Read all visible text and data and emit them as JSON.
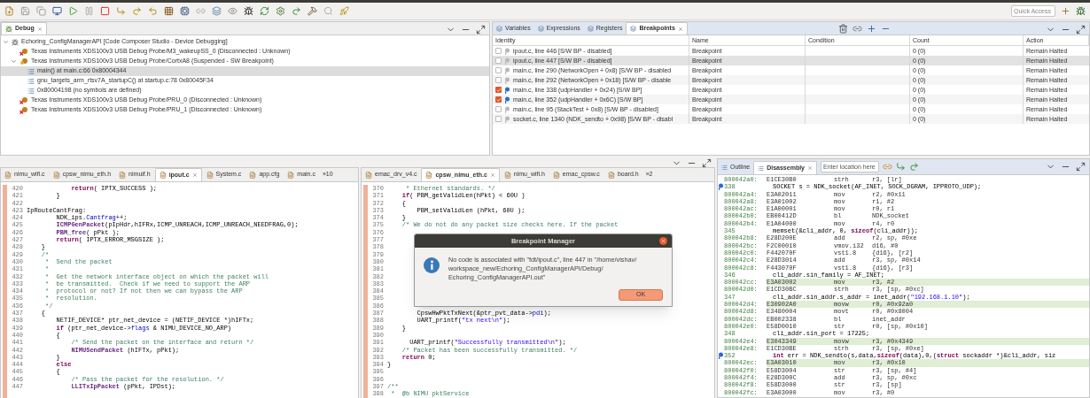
{
  "toolbar": {
    "quick_access": {
      "placeholder": "Quick Access"
    }
  },
  "debug": {
    "tab": {
      "label": "Debug",
      "selected": true
    },
    "tree": [
      {
        "label": "Echoring_ConfigManagerAPI [Code Composer Studio - Device Debugging]",
        "kind": "session",
        "expanded": true,
        "selected": false,
        "children": [
          {
            "label": "Texas Instruments XDS100v3 USB Debug Probe/M3_wakeupSS_0 (Disconnected : Unknown)",
            "kind": "target_off",
            "selected": false
          },
          {
            "label": "Texas Instruments XDS100v3 USB Debug Probe/CortxA8 (Suspended - SW Breakpoint)",
            "kind": "target_on",
            "expanded": true,
            "selected": false,
            "children": [
              {
                "label": "main() at main.c:66 0x80004344",
                "kind": "frame",
                "selected": true
              },
              {
                "label": "gnu_targets_arm_rtsv7A_startupC() at startup.c:78 0x80045F34",
                "kind": "frame",
                "selected": false
              },
              {
                "label": "0x80004198  (no symbols are defined)",
                "kind": "frame",
                "selected": false
              }
            ]
          },
          {
            "label": "Texas Instruments XDS100v3 USB Debug Probe/PRU_0 (Disconnected : Unknown)",
            "kind": "target_off",
            "selected": false
          },
          {
            "label": "Texas Instruments XDS100v3 USB Debug Probe/PRU_1 (Disconnected : Unknown)",
            "kind": "target_off",
            "selected": false
          }
        ]
      }
    ]
  },
  "views": {
    "tabs": [
      {
        "label": "Variables",
        "selected": false
      },
      {
        "label": "Expressions",
        "selected": false
      },
      {
        "label": "Registers",
        "selected": false
      },
      {
        "label": "Breakpoints",
        "selected": true
      }
    ],
    "breakpoints": {
      "columns": [
        "Identity",
        "Name",
        "Condition",
        "Count",
        "Action"
      ],
      "rows": [
        {
          "identity": "ipout.c, line 446 [S/W BP - disabled]",
          "checked": false,
          "selected": false,
          "name": "Breakpoint",
          "count": "0 (0)",
          "action": "Remain Halted"
        },
        {
          "identity": "ipout.c, line 447 [S/W BP - disabled]",
          "checked": false,
          "selected": true,
          "name": "Breakpoint",
          "count": "0 (0)",
          "action": "Remain Halted"
        },
        {
          "identity": "main.c, line 290 (NetworkOpen + 0x8)  [S/W BP - disabled",
          "checked": false,
          "selected": false,
          "name": "Breakpoint",
          "count": "0 (0)",
          "action": "Remain Halted"
        },
        {
          "identity": "main.c, line 292 (NetworkOpen + 0x18)  [S/W BP - disable",
          "checked": false,
          "selected": false,
          "name": "Breakpoint",
          "count": "0 (0)",
          "action": "Remain Halted"
        },
        {
          "identity": "main.c, line 338 (udpHandler + 0x24)  [S/W BP]",
          "checked": true,
          "selected": false,
          "name": "Breakpoint",
          "count": "0 (0)",
          "action": "Remain Halted"
        },
        {
          "identity": "main.c, line 352 (udpHandler + 0x6C)  [S/W BP]",
          "checked": true,
          "selected": false,
          "name": "Breakpoint",
          "count": "0 (0)",
          "action": "Remain Halted"
        },
        {
          "identity": "main.c, line 95 (StackTest + 0x8)  [S/W BP - disabled]",
          "checked": false,
          "selected": false,
          "name": "Breakpoint",
          "count": "0 (0)",
          "action": "Remain Halted"
        },
        {
          "identity": "socket.c, line 1340 (NDK_sendto + 0x98)  [S/W BP - disabl",
          "checked": false,
          "selected": false,
          "name": "Breakpoint",
          "count": "0 (0)",
          "action": "Remain Halted"
        }
      ]
    }
  },
  "editor_left": {
    "tabs": [
      {
        "label": "nimu_wifi.c",
        "selected": false
      },
      {
        "label": "cpsw_nimu_eth.h",
        "selected": false
      },
      {
        "label": "nimuif.h",
        "selected": false
      },
      {
        "label": "ipout.c",
        "selected": true
      },
      {
        "label": "System.c",
        "selected": false
      },
      {
        "label": "app.cfg",
        "selected": false
      },
      {
        "label": "main.c",
        "selected": false
      }
    ],
    "overflow": "»10",
    "lines": [
      {
        "n": "420",
        "code": [
          {
            "kind": "kw",
            "text": "            return"
          },
          {
            "kind": "p",
            "text": "( IPTX_SUCCESS );"
          }
        ]
      },
      {
        "n": "421",
        "code": [
          {
            "kind": "p",
            "text": "        }"
          }
        ]
      },
      {
        "n": "422"
      },
      {
        "n": "423",
        "code": [
          {
            "kind": "p",
            "text": "IpRouteCantFrag:"
          }
        ]
      },
      {
        "n": "424",
        "code": [
          {
            "kind": "p",
            "text": "        NDK_ips."
          },
          {
            "kind": "fd",
            "text": "Cantfrag"
          },
          {
            "kind": "p",
            "text": "++;"
          }
        ]
      },
      {
        "n": "425",
        "code": [
          {
            "kind": "fn",
            "text": "        ICMPGenPacket"
          },
          {
            "kind": "p",
            "text": "(pIpHdr,hIFRx,ICMP_UNREACH,ICMP_UNREACH_NEEDFRAG,0);"
          }
        ]
      },
      {
        "n": "426",
        "code": [
          {
            "kind": "fn",
            "text": "        PBM_free"
          },
          {
            "kind": "p",
            "text": "( pPkt );"
          }
        ]
      },
      {
        "n": "427",
        "code": [
          {
            "kind": "kw",
            "text": "        return"
          },
          {
            "kind": "p",
            "text": "( IPTX_ERROR_MSGSIZE );"
          }
        ]
      },
      {
        "n": "428",
        "code": [
          {
            "kind": "p",
            "text": "    }"
          }
        ]
      },
      {
        "n": "429",
        "code": [
          {
            "kind": "cm",
            "text": "    /*"
          }
        ]
      },
      {
        "n": "430",
        "code": [
          {
            "kind": "cm",
            "text": "     *  Send the packet"
          }
        ]
      },
      {
        "n": "431",
        "code": [
          {
            "kind": "cm",
            "text": "     *"
          }
        ]
      },
      {
        "n": "432",
        "code": [
          {
            "kind": "cm",
            "text": "     *  Get the network interface object on which the packet will"
          }
        ]
      },
      {
        "n": "433",
        "code": [
          {
            "kind": "cm",
            "text": "     *  be transmitted.  Check if we need to support the ARP"
          }
        ]
      },
      {
        "n": "434",
        "code": [
          {
            "kind": "cm",
            "text": "     *  protocol or not? If not then we can bypass the ARP"
          }
        ]
      },
      {
        "n": "435",
        "code": [
          {
            "kind": "cm",
            "text": "     *  resolution."
          }
        ]
      },
      {
        "n": "436",
        "code": [
          {
            "kind": "cm",
            "text": "     */"
          }
        ]
      },
      {
        "n": "437",
        "code": [
          {
            "kind": "p",
            "text": "    {"
          }
        ]
      },
      {
        "n": "438",
        "code": [
          {
            "kind": "p",
            "text": "        NETIF_DEVICE* ptr_net_device = (NETIF_DEVICE *)hIFTx;"
          }
        ]
      },
      {
        "n": "439",
        "code": [
          {
            "kind": "kw",
            "text": "        if"
          },
          {
            "kind": "p",
            "text": " (ptr_net_device->"
          },
          {
            "kind": "fd",
            "text": "flags"
          },
          {
            "kind": "p",
            "text": " & NIMU_DEVICE_NO_ARP)"
          }
        ]
      },
      {
        "n": "440",
        "code": [
          {
            "kind": "p",
            "text": "        {"
          }
        ]
      },
      {
        "n": "441",
        "code": [
          {
            "kind": "cm",
            "text": "            /* Send the packet on the interface and return */"
          }
        ]
      },
      {
        "n": "442",
        "code": [
          {
            "kind": "fn",
            "text": "            NIMUSendPacket"
          },
          {
            "kind": "p",
            "text": " (hIFTx, pPkt);"
          }
        ]
      },
      {
        "n": "443",
        "code": [
          {
            "kind": "p",
            "text": "        }"
          }
        ]
      },
      {
        "n": "444",
        "code": [
          {
            "kind": "kw",
            "text": "        else"
          }
        ]
      },
      {
        "n": "445",
        "code": [
          {
            "kind": "p",
            "text": "        {"
          }
        ]
      },
      {
        "n": "446",
        "code": [
          {
            "kind": "cm",
            "text": "            /* Pass the packet for the resolution. */"
          }
        ]
      },
      {
        "n": "447",
        "code": [
          {
            "kind": "fn",
            "text": "            LLITxIpPacket"
          },
          {
            "kind": "p",
            "text": " (pPkt, IPDst);"
          }
        ]
      }
    ]
  },
  "editor_middle": {
    "tabs": [
      {
        "label": "emac_drv_v4.c",
        "selected": false
      },
      {
        "label": "cpsw_nimu_eth.c",
        "selected": true
      },
      {
        "label": "nimu_wifi.h",
        "selected": false
      },
      {
        "label": "emac_cpsw.c",
        "selected": false
      },
      {
        "label": "board.h",
        "selected": false
      }
    ],
    "overflow": "»2",
    "lines": [
      {
        "n": "370",
        "code": [
          {
            "kind": "cm",
            "text": "     * Ethernet standards. */"
          }
        ]
      },
      {
        "n": "371",
        "code": [
          {
            "kind": "kw",
            "text": "    if"
          },
          {
            "kind": "p",
            "text": "( PBM_getValidLen(hPkt) < 60U )"
          }
        ]
      },
      {
        "n": "372",
        "code": [
          {
            "kind": "p",
            "text": "    {"
          }
        ]
      },
      {
        "n": "373",
        "code": [
          {
            "kind": "p",
            "text": "        PBM_setValidLen (hPkt, 60U );"
          }
        ]
      },
      {
        "n": "374",
        "code": [
          {
            "kind": "p",
            "text": "    }"
          }
        ]
      },
      {
        "n": "375",
        "code": [
          {
            "kind": "cm",
            "text": "    /* We do not do any packet size checks here. If the packet"
          }
        ]
      },
      {
        "n": "376"
      },
      {
        "n": "377"
      },
      {
        "n": "378"
      },
      {
        "n": "379"
      },
      {
        "n": "380"
      },
      {
        "n": "381"
      },
      {
        "n": "382"
      },
      {
        "n": "383"
      },
      {
        "n": "384"
      },
      {
        "n": "385"
      },
      {
        "n": "386"
      },
      {
        "n": "387",
        "code": [
          {
            "kind": "p",
            "text": "        CpswHwPktTxNext(&ptr_pvt_data->"
          },
          {
            "kind": "fd",
            "text": "pdi"
          },
          {
            "kind": "p",
            "text": ");"
          }
        ]
      },
      {
        "n": "388",
        "code": [
          {
            "kind": "p",
            "text": "        UART_printf("
          },
          {
            "kind": "st",
            "text": "\"tx next\\n\""
          },
          {
            "kind": "p",
            "text": ");"
          }
        ]
      },
      {
        "n": "389",
        "code": [
          {
            "kind": "p",
            "text": "    }"
          }
        ]
      },
      {
        "n": "390"
      },
      {
        "n": "391",
        "code": [
          {
            "kind": "p",
            "text": "      UART_printf("
          },
          {
            "kind": "st",
            "text": "\"Successfully transmitted\\n\""
          },
          {
            "kind": "p",
            "text": ");"
          }
        ]
      },
      {
        "n": "392",
        "code": [
          {
            "kind": "cm",
            "text": "    /* Packet has been successfully transmitted. */"
          }
        ]
      },
      {
        "n": "393",
        "code": [
          {
            "kind": "kw",
            "text": "    return"
          },
          {
            "kind": "p",
            "text": " 0;"
          }
        ]
      },
      {
        "n": "394",
        "code": [
          {
            "kind": "p",
            "text": "}"
          }
        ]
      },
      {
        "n": "395"
      },
      {
        "n": "396"
      },
      {
        "n": "397",
        "code": [
          {
            "kind": "cm",
            "text": "/**"
          }
        ]
      },
      {
        "n": "398",
        "code": [
          {
            "kind": "cm",
            "text": " *  @b NIMU pktService"
          }
        ]
      }
    ]
  },
  "dialog": {
    "title": "Breakpoint Manager",
    "message": "No code is associated with \"fdt/ipout.c\", line 447 in \"/home/vishav/ workspace_new/Echoring_ConfigManagerAPI/Debug/ Echoring_ConfigManagerAPI.out\"",
    "button": "OK"
  },
  "disassembly": {
    "tabs": [
      {
        "label": "Outline",
        "selected": false
      },
      {
        "label": "Disassembly",
        "selected": true
      }
    ],
    "location": {
      "placeholder": "Enter location here"
    },
    "rows": [
      {
        "kind": "asm",
        "addr": "800042a0:",
        "hex": "E1CE30B0",
        "op": "strh",
        "args": "r3, [lr]",
        "hl": false
      },
      {
        "kind": "src",
        "line": "338",
        "bp": true,
        "code": [
          {
            "kind": "p",
            "text": "SOCKET s = NDK_socket(AF_INET, SOCK_DGRAM, IPPROTO_UDP);"
          }
        ]
      },
      {
        "kind": "asm",
        "addr": "800042a4:",
        "hex": "E3A02011",
        "op": "mov",
        "args": "r2, #0x11",
        "hl": false
      },
      {
        "kind": "asm",
        "addr": "800042a8:",
        "hex": "E3A01002",
        "op": "mov",
        "args": "r1, #2",
        "hl": false
      },
      {
        "kind": "asm",
        "addr": "800042ac:",
        "hex": "E1A00001",
        "op": "mov",
        "args": "r0, r1",
        "hl": false
      },
      {
        "kind": "asm",
        "addr": "800042b0:",
        "hex": "EB00412D",
        "op": "bl",
        "args": "NDK_socket",
        "hl": false
      },
      {
        "kind": "asm",
        "addr": "800042b4:",
        "hex": "E1A04000",
        "op": "mov",
        "args": "r4, r0",
        "hl": false
      },
      {
        "kind": "src",
        "line": "345",
        "bp": false,
        "code": [
          {
            "kind": "p",
            "text": "memset(&cli_addr, 0, "
          },
          {
            "kind": "kw",
            "text": "sizeof"
          },
          {
            "kind": "p",
            "text": "(cli_addr));"
          }
        ]
      },
      {
        "kind": "asm",
        "addr": "800042b8:",
        "hex": "E28D200E",
        "op": "add",
        "args": "r2, sp, #0xe",
        "hl": false
      },
      {
        "kind": "asm",
        "addr": "800042bc:",
        "hex": "F2C00010",
        "op": "vmov.i32",
        "args": "d16, #0",
        "hl": false
      },
      {
        "kind": "asm",
        "addr": "800042c0:",
        "hex": "F442070F",
        "op": "vst1.8",
        "args": "{d16}, [r2]",
        "hl": false
      },
      {
        "kind": "asm",
        "addr": "800042c4:",
        "hex": "E28D3014",
        "op": "add",
        "args": "r3, sp, #0x14",
        "hl": false
      },
      {
        "kind": "asm",
        "addr": "800042c8:",
        "hex": "F443070F",
        "op": "vst1.8",
        "args": "{d16}, [r3]",
        "hl": false
      },
      {
        "kind": "src",
        "line": "346",
        "bp": false,
        "code": [
          {
            "kind": "p",
            "text": "cli_addr.sin_family = AF_INET;"
          }
        ]
      },
      {
        "kind": "asm",
        "addr": "800042cc:",
        "hex": "E3A03002",
        "op": "mov",
        "args": "r3, #2",
        "hl": true
      },
      {
        "kind": "asm",
        "addr": "800042d0:",
        "hex": "E1CD30BC",
        "op": "strh",
        "args": "r3, [sp, #0xc]",
        "hl": false
      },
      {
        "kind": "src",
        "line": "347",
        "bp": false,
        "code": [
          {
            "kind": "p",
            "text": "cli_addr.sin_addr.s_addr = inet_addr("
          },
          {
            "kind": "st",
            "text": "\"192.168.1.10\""
          },
          {
            "kind": "p",
            "text": ");"
          }
        ]
      },
      {
        "kind": "asm",
        "addr": "800042d4:",
        "hex": "E30902A0",
        "op": "movw",
        "args": "r0, #0x92a0",
        "hl": true
      },
      {
        "kind": "asm",
        "addr": "800042d8:",
        "hex": "E3480004",
        "op": "movt",
        "args": "r0, #0x8004",
        "hl": false
      },
      {
        "kind": "asm",
        "addr": "800042dc:",
        "hex": "EB002338",
        "op": "bl",
        "args": "inet_addr",
        "hl": false
      },
      {
        "kind": "asm",
        "addr": "800042e0:",
        "hex": "E58D0010",
        "op": "str",
        "args": "r0, [sp, #0x10]",
        "hl": false
      },
      {
        "kind": "src",
        "line": "348",
        "bp": false,
        "code": [
          {
            "kind": "p",
            "text": "cli_addr.sin_port = 17225;"
          }
        ]
      },
      {
        "kind": "asm",
        "addr": "800042e4:",
        "hex": "E3043349",
        "op": "movw",
        "args": "r3, #0x4349",
        "hl": true
      },
      {
        "kind": "asm",
        "addr": "800042e8:",
        "hex": "E1CD30BE",
        "op": "strh",
        "args": "r3, [sp, #0xe]",
        "hl": false
      },
      {
        "kind": "src",
        "line": "352",
        "bp": true,
        "code": [
          {
            "kind": "kw",
            "text": "int"
          },
          {
            "kind": "p",
            "text": " err = NDK_sendto(s,data,"
          },
          {
            "kind": "kw",
            "text": "sizeof"
          },
          {
            "kind": "p",
            "text": "(data),0,("
          },
          {
            "kind": "kw",
            "text": "struct"
          },
          {
            "kind": "p",
            "text": " sockaddr *)&cli_addr, siz"
          }
        ]
      },
      {
        "kind": "asm",
        "addr": "800042ec:",
        "hex": "E3A03010",
        "op": "mov",
        "args": "r3, #0x10",
        "hl": true
      },
      {
        "kind": "asm",
        "addr": "800042f0:",
        "hex": "E58D3004",
        "op": "str",
        "args": "r3, [sp, #4]",
        "hl": false
      },
      {
        "kind": "asm",
        "addr": "800042f4:",
        "hex": "E28D300C",
        "op": "add",
        "args": "r3, sp, #0xc",
        "hl": false
      },
      {
        "kind": "asm",
        "addr": "800042f8:",
        "hex": "E58D3000",
        "op": "str",
        "args": "r3, [sp]",
        "hl": false
      },
      {
        "kind": "asm",
        "addr": "800042fc:",
        "hex": "E3A03000",
        "op": "mov",
        "args": "r3, #0",
        "hl": false
      }
    ]
  }
}
